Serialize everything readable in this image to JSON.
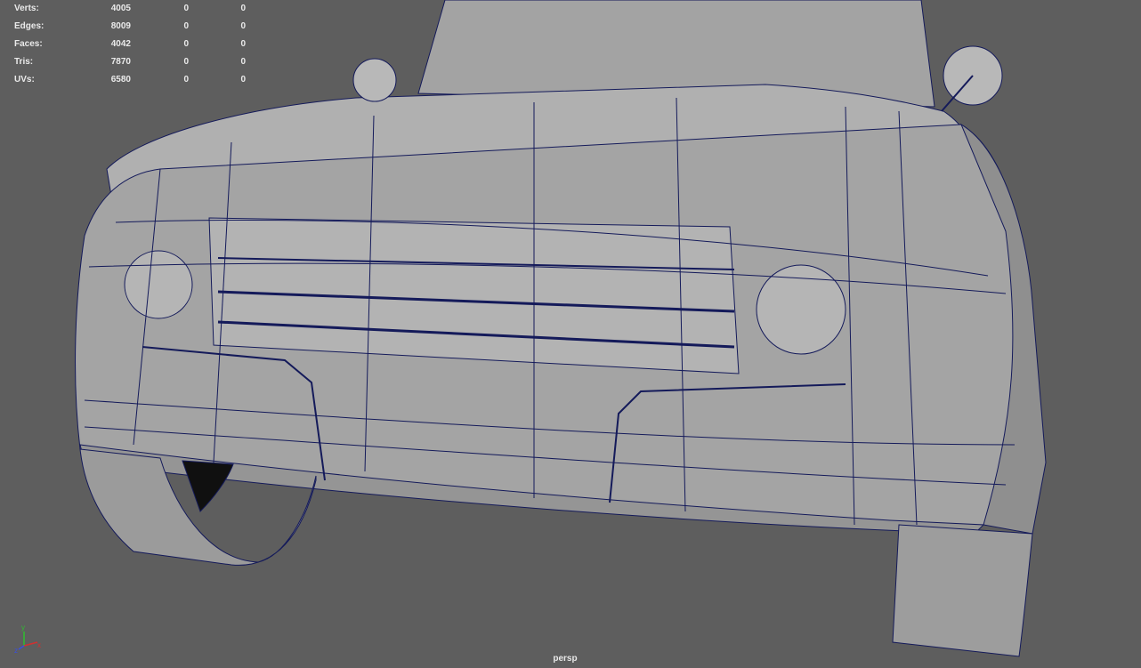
{
  "hud": {
    "rows": [
      {
        "label": "Verts:",
        "v1": "4005",
        "v2": "0",
        "v3": "0"
      },
      {
        "label": "Edges:",
        "v1": "8009",
        "v2": "0",
        "v3": "0"
      },
      {
        "label": "Faces:",
        "v1": "4042",
        "v2": "0",
        "v3": "0"
      },
      {
        "label": "Tris:",
        "v1": "7870",
        "v2": "0",
        "v3": "0"
      },
      {
        "label": "UVs:",
        "v1": "6580",
        "v2": "0",
        "v3": "0"
      }
    ]
  },
  "camera": {
    "name": "persp"
  },
  "axis": {
    "y": "y",
    "x": "x",
    "z": "z"
  },
  "colors": {
    "background": "#5e5e5e",
    "mesh_fill": "#a8a8a8",
    "mesh_shade": "#8c8c8c",
    "wire": "#141a5a",
    "axis_x": "#d23030",
    "axis_y": "#2fbf2f",
    "axis_z": "#3a4fe0"
  }
}
